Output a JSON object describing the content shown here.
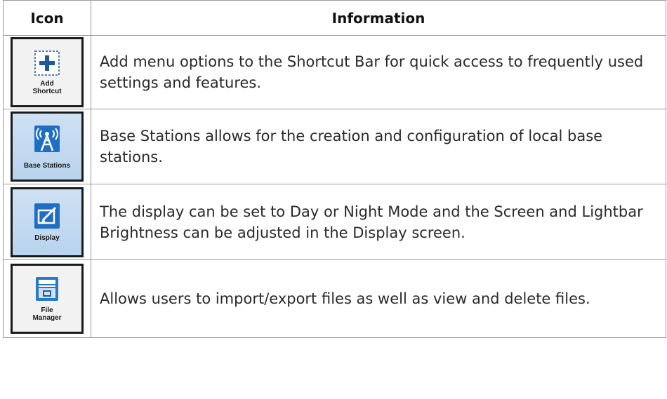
{
  "table": {
    "headers": {
      "icon": "Icon",
      "information": "Information"
    },
    "rows": [
      {
        "icon_name": "add-shortcut-icon",
        "icon_label": "Add\nShortcut",
        "description": "Add menu options to the Shortcut Bar for quick access to frequently used settings and features."
      },
      {
        "icon_name": "base-stations-icon",
        "icon_label": "Base Stations",
        "description": "Base Stations allows for the creation and configuration of local base stations."
      },
      {
        "icon_name": "display-icon",
        "icon_label": "Display",
        "description": "The display can be set to Day or Night Mode and the Screen and Lightbar Brightness can be adjusted in the Display screen."
      },
      {
        "icon_name": "file-manager-icon",
        "icon_label": "File\nManager",
        "description": "Allows users to import/export files as well as view and delete files."
      }
    ]
  },
  "colors": {
    "icon_blue": "#1e6fc4",
    "border": "#9a9a9a",
    "text": "#2a2a2a"
  }
}
